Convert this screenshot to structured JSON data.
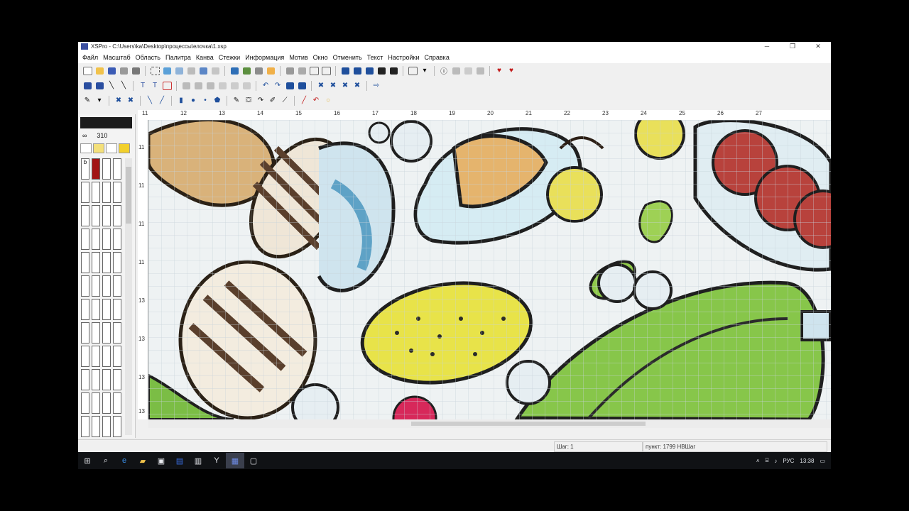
{
  "window": {
    "title": "XSPro - C:\\Users\\ka\\Desktop\\процессы\\елочка\\1.xsp",
    "minimize": "─",
    "maximize": "❐",
    "close": "✕"
  },
  "menu": [
    "Файл",
    "Масштаб",
    "Область",
    "Палитра",
    "Канва",
    "Стежки",
    "Информация",
    "Мотив",
    "Окно",
    "Отменить",
    "Текст",
    "Настройки",
    "Справка"
  ],
  "panel": {
    "zoom_label": "∞",
    "stitch_count": "310",
    "symbol_value": "b",
    "selected_color": "#1c1c1c"
  },
  "ruler": {
    "top_ticks": [
      "11",
      "12",
      "13",
      "14",
      "15",
      "16",
      "17",
      "18",
      "19",
      "20",
      "21",
      "22",
      "23",
      "24",
      "25",
      "26",
      "27"
    ],
    "left_ticks": [
      "11",
      "11",
      "11",
      "11",
      "13",
      "13",
      "13",
      "13"
    ]
  },
  "status": {
    "page": "Шаг: 1",
    "stitches": "пункт: 1799 НВШаг"
  },
  "taskbar": {
    "language": "РУС",
    "time": "13:38"
  },
  "colors": {
    "accent": "#3b4fa0",
    "palette_selected": "#a21414",
    "taskbar": "#101215"
  }
}
